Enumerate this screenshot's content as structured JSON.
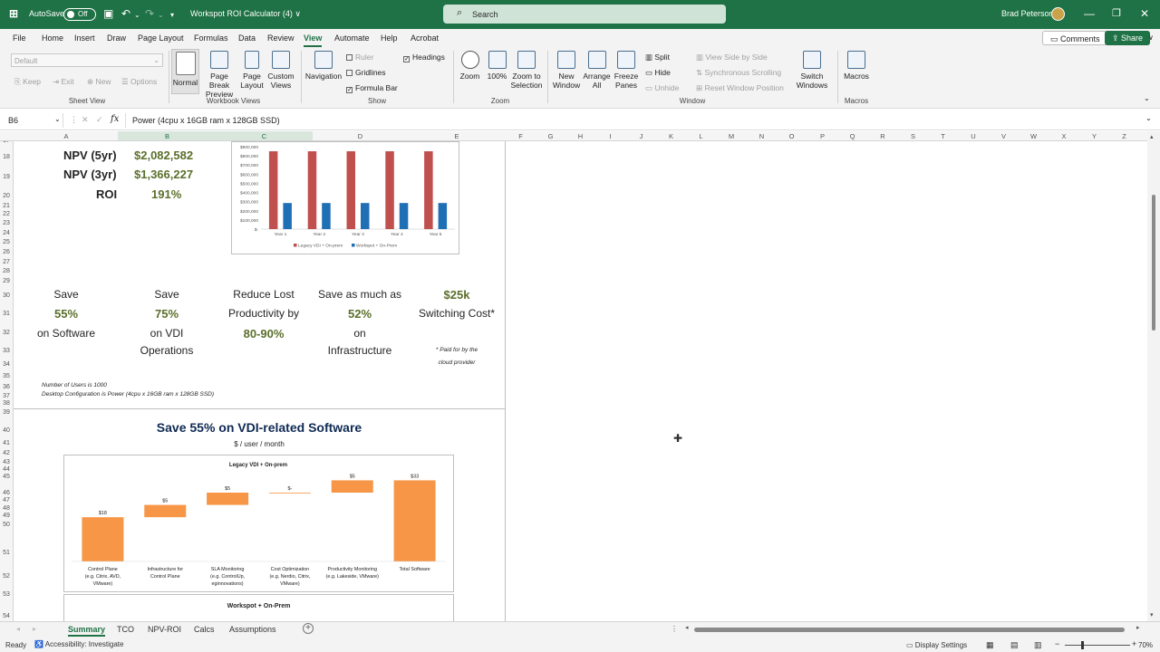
{
  "app": {
    "autosave_label": "AutoSave",
    "autosave_state": "Off",
    "file_title": "Workspot ROI Calculator (4)",
    "file_title_chevron": "∨",
    "search_placeholder": "Search",
    "user_name": "Brad Peterson"
  },
  "menu": {
    "items": [
      "File",
      "Home",
      "Insert",
      "Draw",
      "Page Layout",
      "Formulas",
      "Data",
      "Review",
      "View",
      "Automate",
      "Help",
      "Acrobat"
    ],
    "active": "View",
    "comments_label": "Comments",
    "share_label": "Share"
  },
  "ribbon": {
    "sheet_view": {
      "dropdown": "Default",
      "keep": "Keep",
      "exit": "Exit",
      "new": "New",
      "options": "Options",
      "group": "Sheet View"
    },
    "workbook_views": {
      "normal": "Normal",
      "page_break": "Page Break Preview",
      "page_layout": "Page Layout",
      "custom": "Custom Views",
      "group": "Workbook Views"
    },
    "show": {
      "navigation": "Navigation",
      "ruler": "Ruler",
      "gridlines": "Gridlines",
      "formula_bar": "Formula Bar",
      "headings": "Headings",
      "group": "Show"
    },
    "zoom": {
      "zoom": "Zoom",
      "hundred": "100%",
      "zoom_to_selection": "Zoom to Selection",
      "group": "Zoom"
    },
    "window": {
      "new_window": "New Window",
      "arrange_all": "Arrange All",
      "freeze_panes": "Freeze Panes",
      "split": "Split",
      "hide": "Hide",
      "unhide": "Unhide",
      "view_side": "View Side by Side",
      "sync_scroll": "Synchronous Scrolling",
      "reset_pos": "Reset Window Position",
      "switch_windows": "Switch Windows",
      "group": "Window"
    },
    "macros": {
      "macros": "Macros",
      "group": "Macros"
    }
  },
  "formula_bar": {
    "name_box": "B6",
    "fx": "fx",
    "content": "Power (4cpu x 16GB ram x 128GB SSD)"
  },
  "columns": [
    "A",
    "B",
    "C",
    "D",
    "E",
    "F",
    "G",
    "H",
    "I",
    "J",
    "K",
    "L",
    "M",
    "N",
    "O",
    "P",
    "Q",
    "R",
    "S",
    "T",
    "U",
    "V",
    "W",
    "X",
    "Y",
    "Z"
  ],
  "rows": [
    {
      "n": "17"
    },
    {
      "n": "18"
    },
    {
      "n": "19"
    },
    {
      "n": "20"
    },
    {
      "n": "21"
    },
    {
      "n": "22"
    },
    {
      "n": "23"
    },
    {
      "n": "24"
    },
    {
      "n": "25"
    },
    {
      "n": "26"
    },
    {
      "n": "27"
    },
    {
      "n": "28"
    },
    {
      "n": "29"
    },
    {
      "n": "30"
    },
    {
      "n": "31"
    },
    {
      "n": "32"
    },
    {
      "n": "33"
    },
    {
      "n": "34"
    },
    {
      "n": "35"
    },
    {
      "n": "36"
    },
    {
      "n": "37"
    },
    {
      "n": "38"
    },
    {
      "n": "39"
    },
    {
      "n": "40"
    },
    {
      "n": "41"
    },
    {
      "n": "42"
    },
    {
      "n": "43"
    },
    {
      "n": "44"
    },
    {
      "n": "45"
    },
    {
      "n": "46"
    },
    {
      "n": "47"
    },
    {
      "n": "48"
    },
    {
      "n": "49"
    },
    {
      "n": "50"
    },
    {
      "n": "51"
    },
    {
      "n": "52"
    },
    {
      "n": "53"
    },
    {
      "n": "54"
    },
    {
      "n": "55"
    }
  ],
  "metrics": [
    {
      "label": "NPV (5yr)",
      "value": "$2,082,582"
    },
    {
      "label": "NPV (3yr)",
      "value": "$1,366,227"
    },
    {
      "label": "ROI",
      "value": "191%"
    }
  ],
  "savings": {
    "s1": {
      "a": "Save",
      "b": "55%",
      "c": "on Software"
    },
    "s2": {
      "a": "Save",
      "b": "75%",
      "c": "on VDI",
      "d": "Operations"
    },
    "s3": {
      "a": "Reduce Lost",
      "b": "Productivity by",
      "c": "80-90%"
    },
    "s4": {
      "a": "Save as much as",
      "b": "52%",
      "c": "on",
      "d": "Infrastructure"
    },
    "s5": {
      "a": "$25k",
      "b": "Switching Cost*",
      "c": "* Paid for by the",
      "d": "cloud provider"
    }
  },
  "notes": {
    "users": "Number of Users is 1000",
    "config": "Desktop Configuration is Power (4cpu x 16GB ram x 128GB SSD)"
  },
  "section": {
    "title": "Save 55% on VDI-related Software",
    "subtitle": "$ / user / month"
  },
  "second_chart_title": "Workspot + On-Prem",
  "chart_data": [
    {
      "type": "bar",
      "title": "",
      "categories": [
        "Year 1",
        "Year 2",
        "Year 3",
        "Year 4",
        "Year 5"
      ],
      "series": [
        {
          "name": "Legacy VDI + On-prem",
          "values": [
            850000,
            850000,
            850000,
            850000,
            850000
          ],
          "color": "#c0504d"
        },
        {
          "name": "Workspot + On-Prem",
          "values": [
            285000,
            285000,
            285000,
            285000,
            285000
          ],
          "color": "#1f6fb5"
        }
      ],
      "yticks": [
        "$900,000",
        "$800,000",
        "$700,000",
        "$600,000",
        "$500,000",
        "$400,000",
        "$300,000",
        "$200,000",
        "$100,000",
        "$-"
      ],
      "ylim": [
        0,
        900000
      ],
      "legend": "bottom"
    },
    {
      "type": "waterfall",
      "title": "Legacy VDI + On-prem",
      "categories": [
        "Control Plane (e.g. Citrix, AVD, VMware)",
        "Infrastructure for Control Plane",
        "SLA Monitoring (e.g. ControlUp, eginnovations)",
        "Cost Optimization (e.g. Nerdio, Citrix, VMware)",
        "Productivity Monitoring (e.g. Lakeside, VMware)",
        "Total Software"
      ],
      "category_lines": [
        [
          "Control Plane",
          "(e.g. Citrix, AVD,",
          "VMware)"
        ],
        [
          "Infrastructure for",
          "Control Plane"
        ],
        [
          "SLA Monitoring",
          "(e.g. ControlUp,",
          "eginnovations)"
        ],
        [
          "Cost Optimization",
          "(e.g. Nerdio, Citrix,",
          "VMware)"
        ],
        [
          "Productivity Monitoring",
          "(e.g. Lakeside, VMware)"
        ],
        [
          "Total Software"
        ]
      ],
      "values": [
        18,
        5,
        5,
        0,
        5,
        33
      ],
      "labels": [
        "$18",
        "$5",
        "$5",
        "$-",
        "$5",
        "$33"
      ],
      "total_index": 5,
      "ylim": [
        0,
        35
      ],
      "color": "#f79646"
    }
  ],
  "tabs": {
    "items": [
      "Summary",
      "TCO",
      "NPV-ROI",
      "Calcs",
      "Assumptions"
    ],
    "active": "Summary"
  },
  "status": {
    "ready": "Ready",
    "accessibility": "Accessibility: Investigate",
    "display_settings": "Display Settings",
    "zoom": "70%"
  }
}
